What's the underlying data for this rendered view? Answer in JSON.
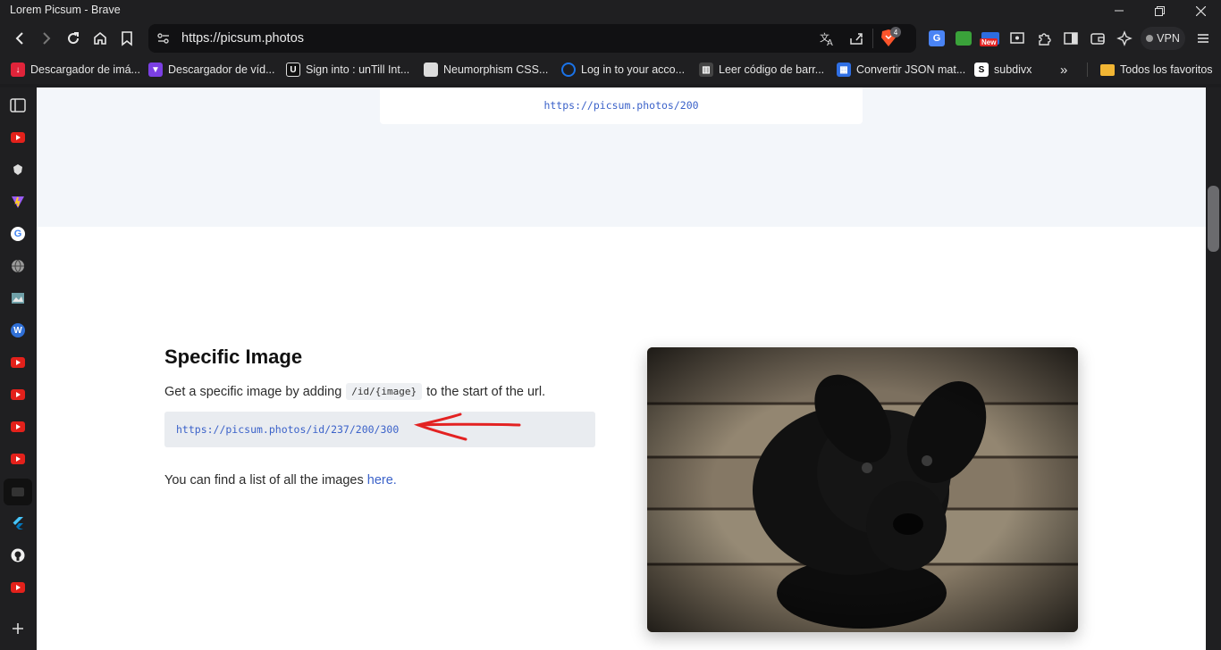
{
  "window": {
    "title": "Lorem Picsum - Brave"
  },
  "toolbar": {
    "url": "https://picsum.photos",
    "vpn_label": "VPN",
    "brave_badge_count": "4",
    "new_badge": "New"
  },
  "bookmarks": {
    "items": [
      {
        "label": "Descargador de imá...",
        "icon": "download-icon",
        "color": "#e0243a"
      },
      {
        "label": "Descargador de víd...",
        "icon": "video-download-icon",
        "color": "#7b3fe4"
      },
      {
        "label": "Sign into : unTill Int...",
        "icon": "untill-icon",
        "color": "#2b2b2b"
      },
      {
        "label": "Neumorphism CSS...",
        "icon": "neumorphism-icon",
        "color": "#dcdcdc"
      },
      {
        "label": "Log in to your acco...",
        "icon": "login-icon",
        "color": "#1a73e8"
      },
      {
        "label": "Leer código de barr...",
        "icon": "barcode-icon",
        "color": "#444444"
      },
      {
        "label": "Convertir JSON mat...",
        "icon": "json-icon",
        "color": "#2f6fe4"
      },
      {
        "label": "subdivx",
        "icon": "subdivx-icon",
        "color": "#ffffff"
      }
    ],
    "overflow_label": "»",
    "all_favorites_label": "Todos los favoritos"
  },
  "page": {
    "top_code": "https://picsum.photos/200",
    "section_title": "Specific Image",
    "description_before": "Get a specific image by adding",
    "description_code": "/id/{image}",
    "description_after": "to the start of the url.",
    "example_code": "https://picsum.photos/id/237/200/300",
    "find_text": "You can find a list of all the images",
    "find_link": "here."
  },
  "colors": {
    "accent_link": "#3b62c9",
    "arrow_annotation": "#e32222",
    "band_background": "#f3f6fa"
  }
}
